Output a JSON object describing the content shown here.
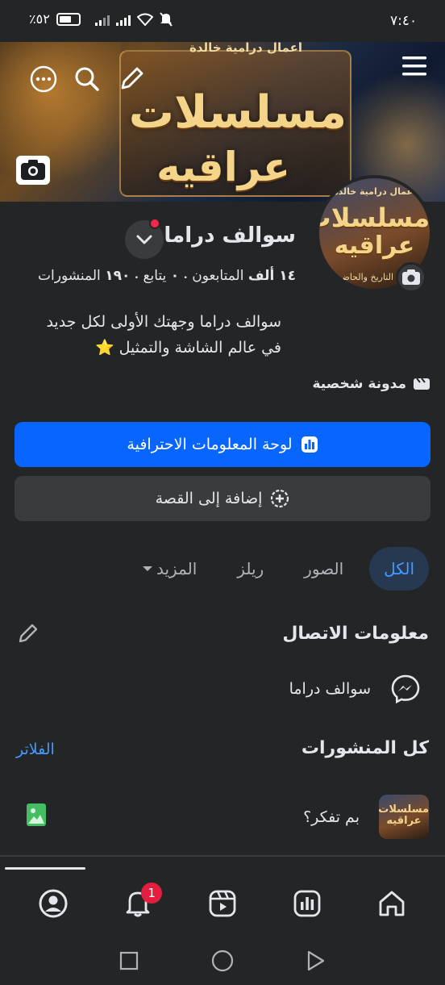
{
  "status_bar": {
    "time": "٧:٤٠",
    "battery": "٪٥٢"
  },
  "cover": {
    "top_text": "أعمال درامية خالدة",
    "title_line1": "مسلسلات",
    "title_line2": "عراقيه"
  },
  "profile_picture": {
    "top_text": "أعمال درامية خالدة",
    "title_line1": "مسلسلات",
    "title_line2": "عراقيه",
    "bottom_text": "عبق التاريخ والحاضر"
  },
  "page": {
    "name": "سوالف دراما",
    "followers_count": "١٤ ألف",
    "followers_label": "المتابعون",
    "following_count": "٠",
    "following_label": "يتابع",
    "posts_count": "١٩٠",
    "posts_label": "المنشورات",
    "separator": "•",
    "bio_line1": "سوالف دراما وجهتك الأولى لكل جديد",
    "bio_line2": "في عالم الشاشة  والتمثيل",
    "bio_emoji": "⭐",
    "category": "مدونة شخصية"
  },
  "buttons": {
    "professional_dashboard": "لوحة المعلومات الاحترافية",
    "add_to_story": "إضافة إلى القصة"
  },
  "tabs": [
    {
      "label": "الكل",
      "active": true
    },
    {
      "label": "الصور",
      "active": false
    },
    {
      "label": "ريلز",
      "active": false
    },
    {
      "label": "المزيد",
      "active": false
    }
  ],
  "contact": {
    "title": "معلومات الاتصال",
    "messenger_name": "سوالف دراما"
  },
  "posts": {
    "title": "كل المنشورات",
    "filters": "الفلاتر",
    "composer_placeholder": "بم تفكر؟",
    "avatar_text": "مسلسلات عراقيه"
  },
  "bottom_nav": {
    "notifications_badge": "1"
  },
  "colors": {
    "background": "#242526",
    "accent": "#0866ff",
    "link": "#4599ff",
    "badge": "#e41e3f"
  }
}
